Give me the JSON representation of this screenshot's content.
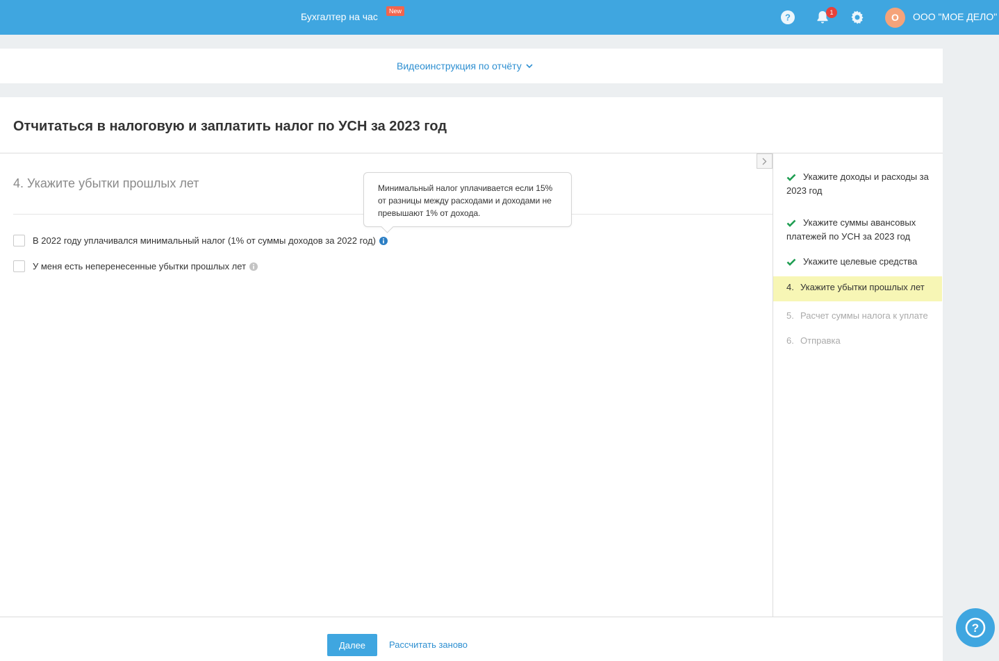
{
  "topbar": {
    "service_label": "Бухгалтер на час",
    "new_badge": "New",
    "notification_count": "1",
    "avatar_initial": "О",
    "company_name": "ООО \"МОЕ ДЕЛО\""
  },
  "video_bar": {
    "link_label": "Видеоинструкция по отчёту"
  },
  "page": {
    "title": "Отчитаться в налоговую и заплатить налог по УСН за 2023 год"
  },
  "step": {
    "title": "4. Укажите убытки прошлых лет",
    "options": [
      {
        "label": "В 2022 году уплачивался минимальный налог (1% от суммы доходов за 2022 год)",
        "checked": false
      },
      {
        "label": "У меня есть неперенесенные убытки прошлых лет",
        "checked": false
      }
    ],
    "tooltip": "Минимальный налог уплачивается если 15% от разницы между расходами и доходами не превышают 1% от дохода."
  },
  "sidebar": {
    "steps": [
      {
        "label": "Укажите доходы и расходы за 2023 год",
        "state": "done"
      },
      {
        "label": "Укажите суммы авансовых платежей по УСН за 2023 год",
        "state": "done"
      },
      {
        "label": "Укажите целевые средства",
        "state": "done"
      },
      {
        "number": "4.",
        "label": "Укажите убытки прошлых лет",
        "state": "active"
      },
      {
        "number": "5.",
        "label": "Расчет суммы налога к уплате",
        "state": "pending"
      },
      {
        "number": "6.",
        "label": "Отправка",
        "state": "pending"
      }
    ]
  },
  "actions": {
    "next_label": "Далее",
    "recalc_label": "Рассчитать заново"
  },
  "colors": {
    "primary": "#3fa6e0",
    "link": "#2d8fd1",
    "done_check": "#1f9e52",
    "active_step_bg": "#f7f6b5"
  }
}
